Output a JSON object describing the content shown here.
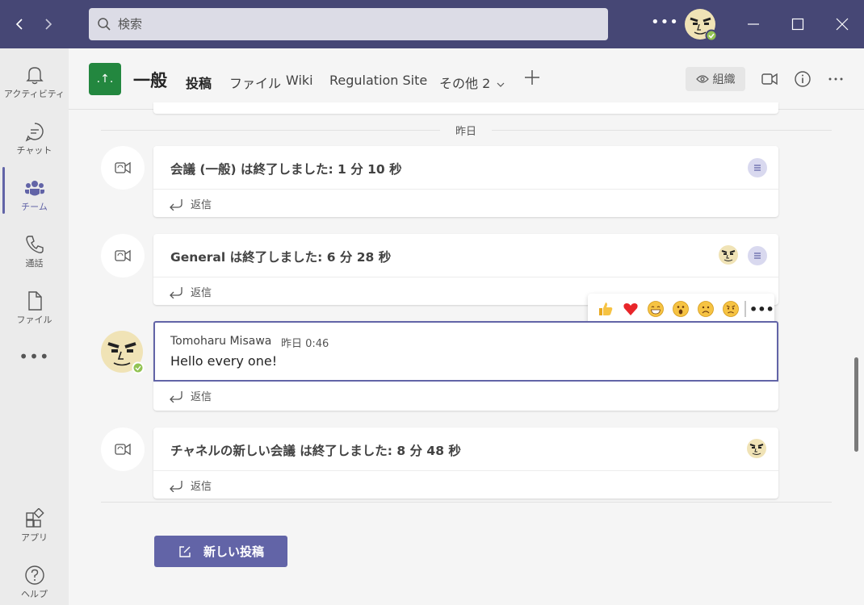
{
  "titlebar": {
    "search_placeholder": "検索",
    "more_label": "•••",
    "status": "available"
  },
  "rail": {
    "items": [
      {
        "label": "アクティビティ",
        "icon": "bell-icon"
      },
      {
        "label": "チャット",
        "icon": "chat-icon"
      },
      {
        "label": "チーム",
        "icon": "teams-icon"
      },
      {
        "label": "通話",
        "icon": "phone-icon"
      },
      {
        "label": "ファイル",
        "icon": "file-icon"
      }
    ],
    "more_label": "•••",
    "bottom_items": [
      {
        "label": "アプリ",
        "icon": "apps-icon"
      },
      {
        "label": "ヘルプ",
        "icon": "help-icon"
      }
    ]
  },
  "channel": {
    "team_initials": ".↑.",
    "name": "一般",
    "tabs": [
      {
        "label": "投稿",
        "active": true
      },
      {
        "label": "ファイル"
      },
      {
        "label": "Wiki"
      },
      {
        "label": "Regulation Site"
      },
      {
        "label": "その他 2"
      }
    ],
    "org_label": "組織"
  },
  "feed": {
    "date_divider": "昨日",
    "reply_label": "返信",
    "threads": [
      {
        "title": "会議 (一般) は終了しました: 1 分 10 秒"
      },
      {
        "title": "General は終了しました: 6 分 28 秒"
      },
      {
        "title": "チャネルの新しい会議 は終了しました: 8 分 48 秒"
      }
    ],
    "message": {
      "author": "Tomoharu Misawa",
      "time": "昨日 0:46",
      "text": "Hello every one!"
    },
    "reactions": [
      "like-icon",
      "heart-icon",
      "laugh-icon",
      "surprised-icon",
      "sad-icon",
      "angry-icon"
    ],
    "reactions_more": "•••",
    "new_post_label": "新しい投稿"
  },
  "colors": {
    "titlebar": "#464775",
    "accent": "#6264a7",
    "team_avatar": "#23873f"
  }
}
